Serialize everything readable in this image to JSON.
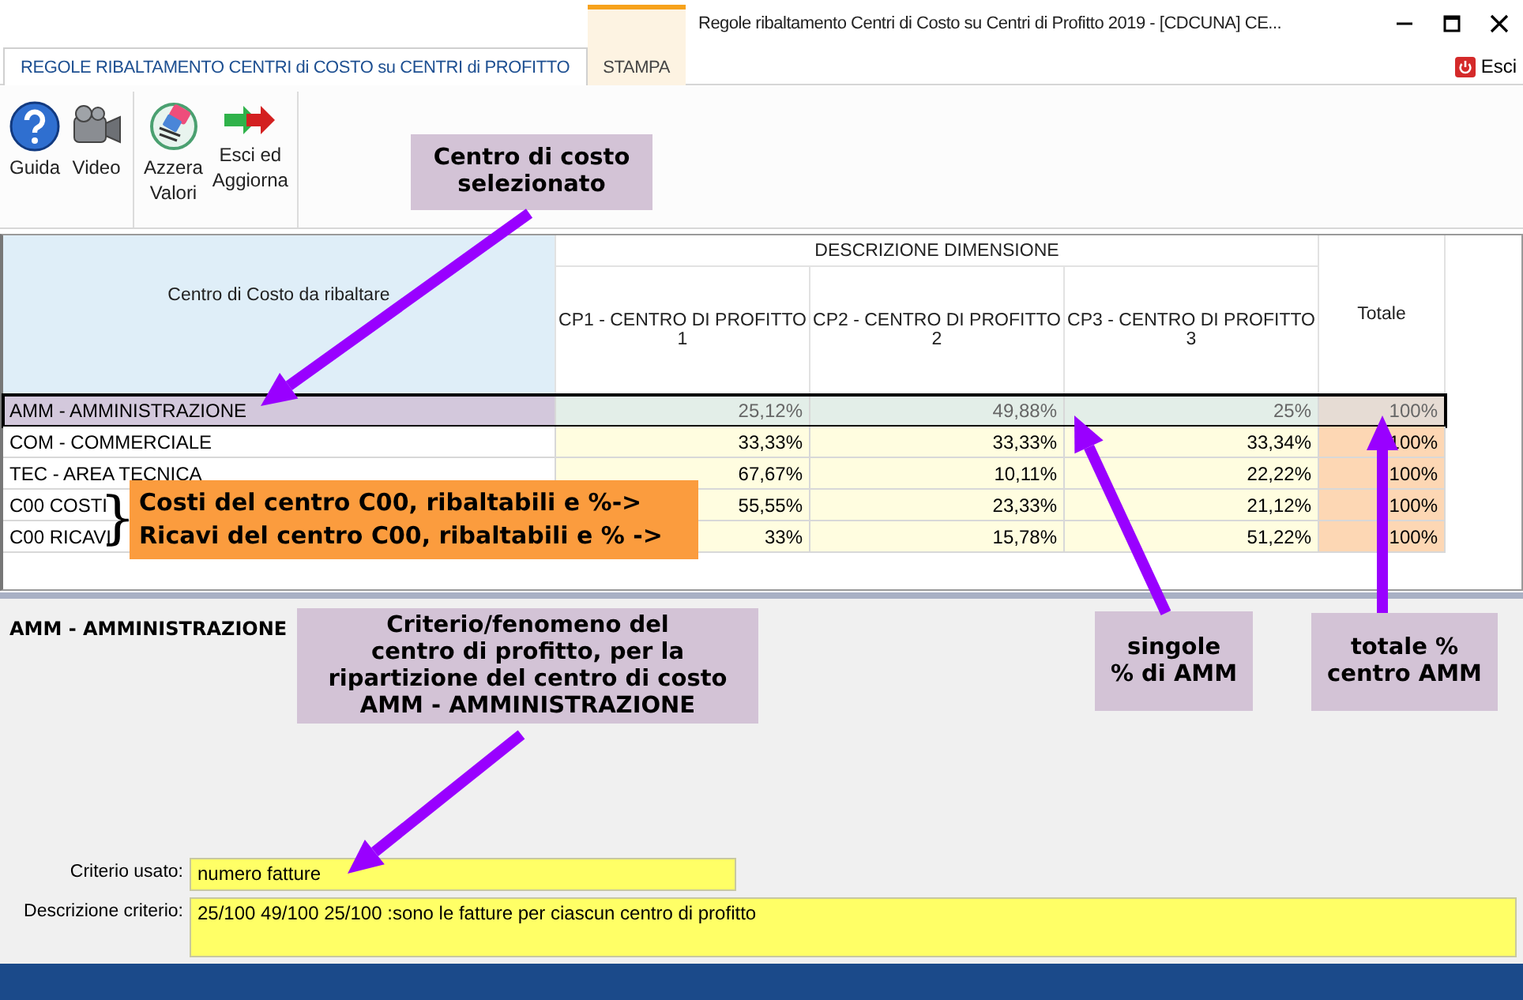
{
  "window": {
    "title": "Regole ribaltamento Centri di Costo su Centri di Profitto 2019 - [CDCUNA] CE..."
  },
  "tabs": [
    {
      "label": "REGOLE RIBALTAMENTO CENTRI di COSTO su CENTRI di PROFITTO",
      "selected": true
    },
    {
      "label": "STAMPA",
      "selected": false
    }
  ],
  "exit_button": {
    "label": "Esci"
  },
  "toolbar": {
    "groups": [
      [
        {
          "kind": "help",
          "label": "Guida"
        },
        {
          "kind": "video",
          "label": "Video"
        }
      ],
      [
        {
          "kind": "reset",
          "label": "Azzera\nValori"
        },
        {
          "kind": "exit",
          "label": "Esci ed\nAggiorna"
        }
      ]
    ]
  },
  "grid": {
    "row_header": "Centro di Costo da ribaltare",
    "group_header": "DESCRIZIONE DIMENSIONE",
    "columns": [
      "CP1 - CENTRO DI PROFITTO\n1",
      "CP2 - CENTRO DI PROFITTO\n2",
      "CP3 - CENTRO DI PROFITTO\n3"
    ],
    "total_header": "Totale",
    "rows": [
      {
        "name": "AMM - AMMINISTRAZIONE",
        "selected": true,
        "values": [
          "25,12%",
          "49,88%",
          "25%"
        ],
        "total": "100%"
      },
      {
        "name": "COM - COMMERCIALE",
        "selected": false,
        "values": [
          "33,33%",
          "33,33%",
          "33,34%"
        ],
        "total": "100%"
      },
      {
        "name": "TEC - AREA TECNICA",
        "selected": false,
        "values": [
          "67,67%",
          "10,11%",
          "22,22%"
        ],
        "total": "100%"
      },
      {
        "name": "C00 COSTI",
        "selected": false,
        "values": [
          "55,55%",
          "23,33%",
          "21,12%"
        ],
        "total": "100%"
      },
      {
        "name": "C00 RICAVI",
        "selected": false,
        "values": [
          "33%",
          "15,78%",
          "51,22%"
        ],
        "total": "100%"
      }
    ]
  },
  "detail": {
    "title": "AMM - AMMINISTRAZIONE",
    "fields": [
      {
        "label": "Criterio usato:",
        "value": "numero fatture"
      },
      {
        "label": "Descrizione criterio:",
        "value": "25/100 49/100 25/100 :sono le fatture per ciascun centro di profitto"
      }
    ]
  },
  "annotations": [
    {
      "kind": "callout",
      "text": "Centro di costo\nselezionato"
    },
    {
      "kind": "note",
      "brace": "}",
      "lines": [
        "Costi del centro C00, ribaltabili e %->",
        "Ricavi del centro C00, ribaltabili e % ->"
      ]
    },
    {
      "kind": "callout",
      "text": "Criterio/fenomeno del\ncentro di profitto, per la\nripartizione del centro di costo\nAMM - AMMINISTRAZIONE"
    },
    {
      "kind": "callout",
      "text": "singole\n% di AMM"
    },
    {
      "kind": "callout",
      "text": "totale  %\ncentro AMM"
    }
  ]
}
